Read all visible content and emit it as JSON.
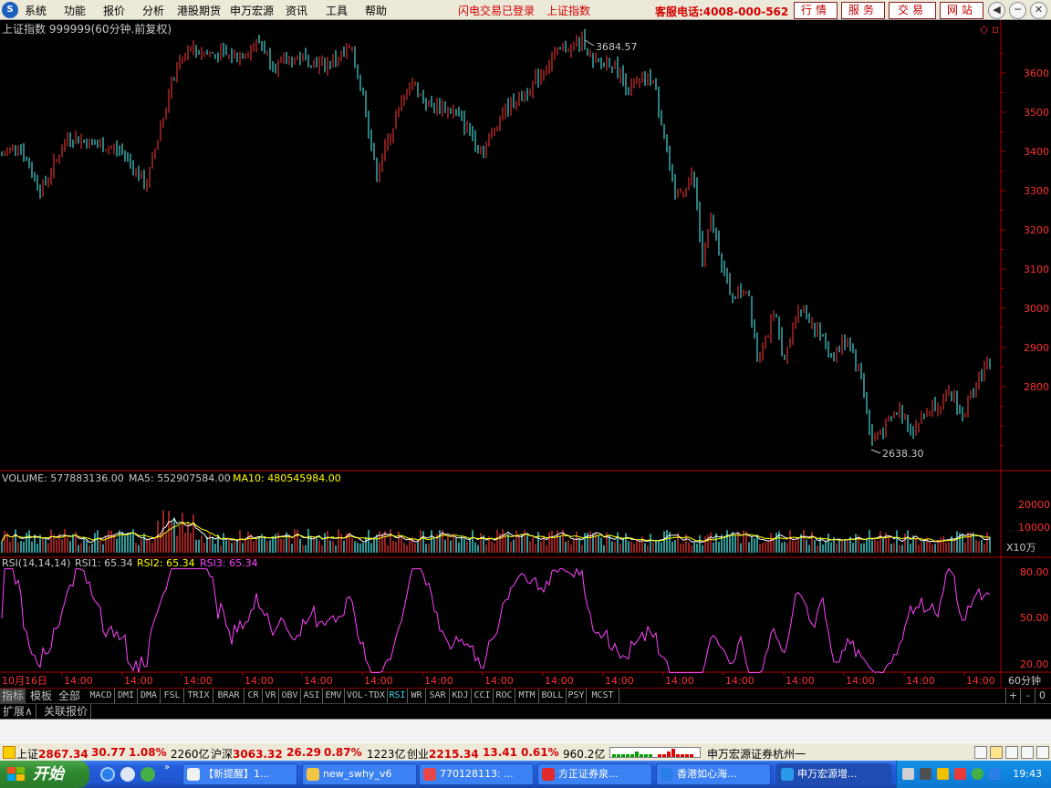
{
  "menubar": {
    "logo": "S",
    "items": [
      "系统",
      "功能",
      "报价",
      "分析",
      "港股期货",
      "申万宏源",
      "资讯",
      "工具",
      "帮助"
    ],
    "login_status": "闪电交易已登录",
    "current_index": "上证指数",
    "phone": "客服电话:4008-000-562",
    "quick_buttons": [
      "行情",
      "服务",
      "交易",
      "网站"
    ],
    "window_controls": [
      "◀",
      "─",
      "▢",
      "✕"
    ]
  },
  "chart": {
    "title": "上证指数 999999(60分钟.前复权)",
    "corner_icons": [
      "◇",
      "▫"
    ],
    "high_label": "3684.57",
    "low_label": "2638.30",
    "y_ticks": [
      "3600",
      "3500",
      "3400",
      "3300",
      "3200",
      "3100",
      "3000",
      "2900",
      "2800"
    ],
    "volume": {
      "label_volume": "VOLUME: 577883136.00",
      "label_ma5": "MA5: 552907584.00",
      "label_ma10": "MA10: 480545984.00",
      "y_ticks": [
        "20000",
        "10000"
      ],
      "unit": "X10万"
    },
    "rsi": {
      "label_main": "RSI(14,14,14)",
      "label_rsi1": "RSI1: 65.34",
      "label_rsi2": "RSI2: 65.34",
      "label_rsi3": "RSI3: 65.34",
      "y_ticks": [
        "80.00",
        "50.00",
        "20.00"
      ]
    },
    "x_labels": [
      "10月16日",
      "14:00",
      "14:00",
      "14:00",
      "14:00",
      "14:00",
      "14:00",
      "14:00",
      "14:00",
      "14:00",
      "14:00",
      "14:00",
      "14:00",
      "14:00",
      "14:00",
      "14:00",
      "14:00"
    ],
    "period": "60分钟",
    "colors": {
      "up": "#ff3a3a",
      "down": "#54ffff",
      "ma5": "#ffffff",
      "ma10": "#ffff00",
      "rsi": "#ff44ff",
      "axis": "#b00000"
    }
  },
  "indicator_tabs": {
    "lead": [
      "指标",
      "模板",
      "全部"
    ],
    "tabs": [
      "MACD",
      "DMI",
      "DMA",
      "FSL",
      "TRIX",
      "BRAR",
      "CR",
      "VR",
      "OBV",
      "ASI",
      "EMV",
      "VOL-TDX",
      "RSI",
      "WR",
      "SAR",
      "KDJ",
      "CCI",
      "ROC",
      "MTM",
      "BOLL",
      "PSY",
      "MCST"
    ],
    "active": "RSI",
    "controls": [
      "+",
      "-",
      "0"
    ]
  },
  "extension_tabs": [
    "扩展∧",
    "关联报价"
  ],
  "index_bar": [
    {
      "name": "上证",
      "value": "2867.34",
      "change": "30.77",
      "pct": "1.08%",
      "amount": "2260亿"
    },
    {
      "name": "沪深",
      "value": "3063.32",
      "change": "26.29",
      "pct": "0.87%",
      "amount": "1223亿"
    },
    {
      "name": "创业",
      "value": "2215.34",
      "change": "13.41",
      "pct": "0.61%",
      "amount": "960.2亿"
    }
  ],
  "company": "申万宏源证券杭州一",
  "taskbar": {
    "start": "开始",
    "tasks": [
      "【新提醒】1...",
      "new_swhy_v6",
      "770128113: ...",
      "方正证券泉...",
      "香港如心海...",
      "申万宏源增..."
    ],
    "active_task": 5,
    "clock": "19:43"
  }
}
